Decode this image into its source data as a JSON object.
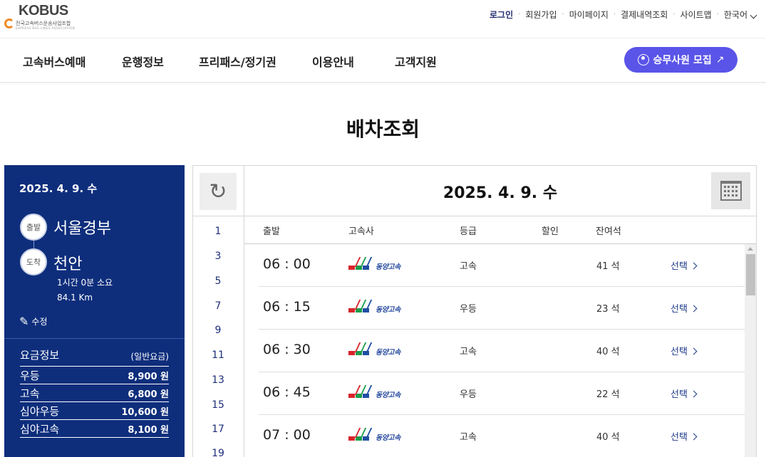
{
  "logo": {
    "word": "KOBUS",
    "sub": "전국고속버스운송사업조합",
    "sub_en": "EXPRESS BUS LINES ASSOCIATION"
  },
  "utility": [
    "로그인",
    "회원가입",
    "마이페이지",
    "결제내역조회",
    "사이트맵",
    "한국어"
  ],
  "nav": [
    "고속버스예매",
    "운행정보",
    "프리패스/정기권",
    "이용안내",
    "고객지원"
  ],
  "recruit_button": {
    "label": "승무사원 모집",
    "arrow": "↗"
  },
  "page_title": "배차조회",
  "summary": {
    "date": "2025. 4. 9. 수",
    "depart_badge": "출발",
    "depart": "서울경부",
    "arrive_badge": "도착",
    "arrive": "천안",
    "duration": "1시간 0분 소요",
    "distance": "84.1 Km",
    "edit_label": "수정"
  },
  "fare": {
    "title": "요금정보",
    "subtitle": "(일반요금)",
    "rows": [
      {
        "grade": "우등",
        "amount": "8,900 원"
      },
      {
        "grade": "고속",
        "amount": "6,800 원"
      },
      {
        "grade": "심야우등",
        "amount": "10,600 원"
      },
      {
        "grade": "심야고속",
        "amount": "8,100 원"
      }
    ]
  },
  "panel": {
    "date": "2025. 4. 9. 수",
    "hours": [
      "1",
      "3",
      "5",
      "7",
      "9",
      "11",
      "13",
      "15",
      "17",
      "19"
    ],
    "columns": {
      "depart": "출발",
      "company": "고속사",
      "grade": "등급",
      "discount": "할인",
      "seats": "잔여석"
    },
    "rows": [
      {
        "time": "06 : 00",
        "company": "동양고속",
        "grade": "고속",
        "seats": "41 석",
        "select": "선택"
      },
      {
        "time": "06 : 15",
        "company": "동양고속",
        "grade": "우등",
        "seats": "23 석",
        "select": "선택"
      },
      {
        "time": "06 : 30",
        "company": "동양고속",
        "grade": "고속",
        "seats": "40 석",
        "select": "선택"
      },
      {
        "time": "06 : 45",
        "company": "동양고속",
        "grade": "우등",
        "seats": "22 석",
        "select": "선택"
      },
      {
        "time": "07 : 00",
        "company": "동양고속",
        "grade": "고속",
        "seats": "40 석",
        "select": "선택"
      }
    ]
  },
  "colors": {
    "navy": "#0e2e7c",
    "accent": "#5a54e8",
    "link": "#1e3a8a"
  }
}
